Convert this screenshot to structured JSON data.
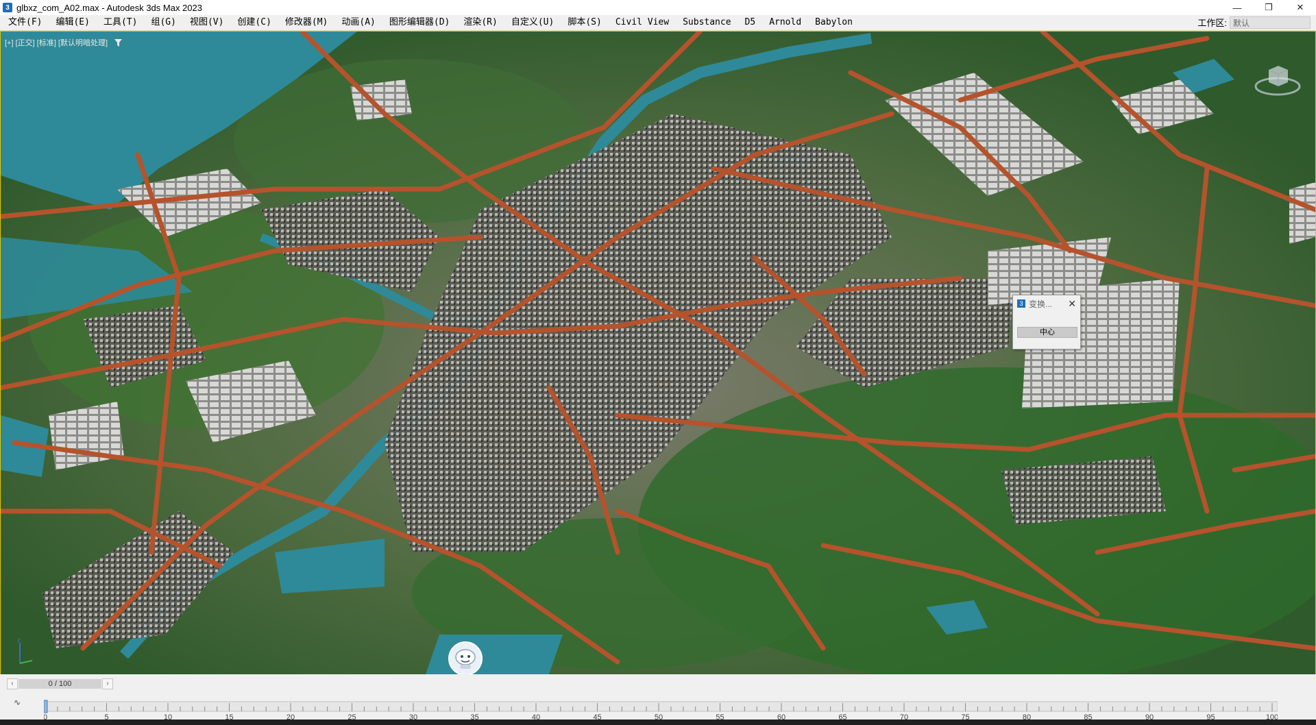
{
  "window": {
    "title": "glbxz_com_A02.max - Autodesk 3ds Max 2023",
    "app_icon_glyph": "3",
    "minimize_icon": "—",
    "restore_icon": "❐",
    "close_icon": "✕"
  },
  "menu": [
    "文件(F)",
    "编辑(E)",
    "工具(T)",
    "组(G)",
    "视图(V)",
    "创建(C)",
    "修改器(M)",
    "动画(A)",
    "图形编辑器(D)",
    "渲染(R)",
    "自定义(U)",
    "脚本(S)",
    "Civil View",
    "Substance",
    "D5",
    "Arnold",
    "Babylon"
  ],
  "workspace": {
    "label": "工作区:",
    "value": "默认"
  },
  "viewport": {
    "label": "[+] [正交] [标准] [默认明暗处理]",
    "accent_border": "#e6c700",
    "terrain_color": "#3d5e35",
    "road_color": "#b5532c",
    "water_color": "#2e8a98"
  },
  "dialog": {
    "icon_glyph": "3",
    "title": "变换...",
    "close": "✕",
    "button": "中心"
  },
  "timeline": {
    "frame_display": "0 / 100",
    "prev_arrow": "‹",
    "next_arrow": "›",
    "track_icon": "∿",
    "ticks": [
      "0",
      "5",
      "10",
      "15",
      "20",
      "25",
      "30",
      "35",
      "40",
      "45",
      "50",
      "55",
      "60",
      "65",
      "70",
      "75",
      "80",
      "85",
      "90",
      "95",
      "100"
    ]
  }
}
